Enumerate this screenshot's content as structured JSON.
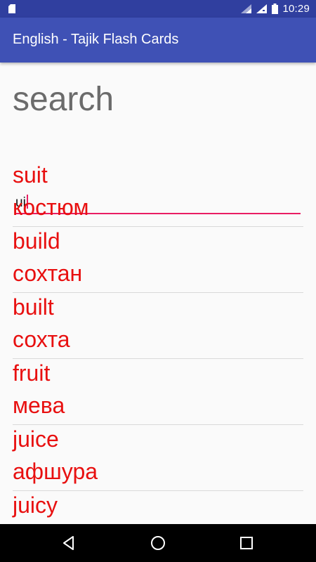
{
  "status_bar": {
    "time": "10:29",
    "icons": [
      "sd-card-icon",
      "wifi-icon",
      "signal-icon",
      "battery-icon"
    ]
  },
  "app_bar": {
    "title": "English - Tajik Flash Cards",
    "color": "#3f51b5"
  },
  "search": {
    "heading": "search",
    "value": "ui",
    "underline_color": "#e91e63"
  },
  "results": [
    {
      "english": "suit",
      "tajik": "костюм"
    },
    {
      "english": "build",
      "tajik": "сохтан"
    },
    {
      "english": "built",
      "tajik": "сохта"
    },
    {
      "english": "fruit",
      "tajik": "мева"
    },
    {
      "english": "juice",
      "tajik": "афшура"
    },
    {
      "english": "juicy",
      "tajik": ""
    }
  ],
  "result_text_color": "#e81010",
  "nav_bar": {
    "icons": [
      "back-icon",
      "home-icon",
      "recents-icon"
    ]
  }
}
